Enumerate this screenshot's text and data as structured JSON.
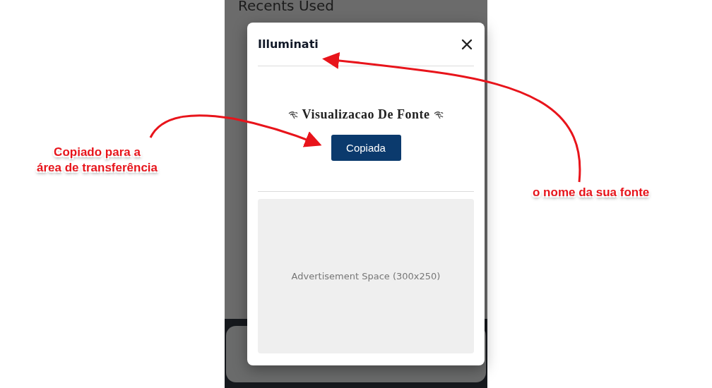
{
  "page": {
    "heading": "Recents Used"
  },
  "modal": {
    "title": "Illuminati",
    "preview_text": "Visualizacao De Fonte",
    "copy_button": "Copiada",
    "ad_text": "Advertisement Space (300x250)"
  },
  "annotations": [
    {
      "label": "Copiado para a\nárea de transferência"
    },
    {
      "label": "o nome da sua fonte"
    }
  ]
}
